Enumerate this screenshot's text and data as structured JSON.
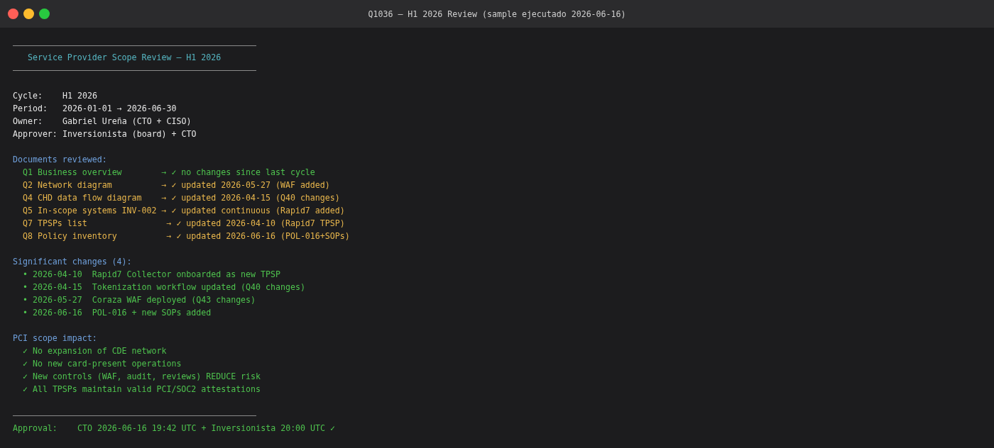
{
  "window": {
    "title": "Q1036 — H1 2026 Review (sample ejecutado 2026-06-16)"
  },
  "header": {
    "title": "Service Provider Scope Review — H1 2026"
  },
  "fields": [
    {
      "label": "Cycle:",
      "value": "H1 2026"
    },
    {
      "label": "Period:",
      "value": "2026-01-01 → 2026-06-30"
    },
    {
      "label": "Owner:",
      "value": "Gabriel Ureña (CTO + CISO)"
    },
    {
      "label": "Approver:",
      "value": "Inversionista (board) + CTO"
    }
  ],
  "sections": [
    {
      "heading": "Documents reviewed:",
      "items": [
        {
          "text": "Q1 Business overview        → ✓ no changes since last cycle",
          "color": "#4ec24e"
        },
        {
          "text": "Q2 Network diagram          → ✓ updated 2026-05-27 (WAF added)",
          "color": "#e8b64c"
        },
        {
          "text": "Q4 CHD data flow diagram    → ✓ updated 2026-04-15 (Q40 changes)",
          "color": "#e8b64c"
        },
        {
          "text": "Q5 In-scope systems INV-002 → ✓ updated continuous (Rapid7 added)",
          "color": "#e8b64c"
        },
        {
          "text": "Q7 TPSPs list                → ✓ updated 2026-04-10 (Rapid7 TPSP)",
          "color": "#e8b64c"
        },
        {
          "text": "Q8 Policy inventory          → ✓ updated 2026-06-16 (POL-016+SOPs)",
          "color": "#e8b64c"
        }
      ]
    },
    {
      "heading": "Significant changes (4):",
      "items": [
        {
          "text": "• 2026-04-10  Rapid7 Collector onboarded as new TPSP",
          "color": "#4ec24e"
        },
        {
          "text": "• 2026-04-15  Tokenization workflow updated (Q40 changes)",
          "color": "#4ec24e"
        },
        {
          "text": "• 2026-05-27  Coraza WAF deployed (Q43 changes)",
          "color": "#4ec24e"
        },
        {
          "text": "• 2026-06-16  POL-016 + new SOPs added",
          "color": "#4ec24e"
        }
      ]
    },
    {
      "heading": "PCI scope impact:",
      "items": [
        {
          "text": "✓ No expansion of CDE network",
          "color": "#4ec24e"
        },
        {
          "text": "✓ No new card-present operations",
          "color": "#4ec24e"
        },
        {
          "text": "✓ New controls (WAF, audit, reviews) REDUCE risk",
          "color": "#4ec24e"
        },
        {
          "text": "✓ All TPSPs maintain valid PCI/SOC2 attestations",
          "color": "#4ec24e"
        }
      ]
    }
  ],
  "approval": {
    "label": "Approval:",
    "value": "CTO 2026-06-16 19:42 UTC + Inversionista 20:00 UTC ✓"
  }
}
